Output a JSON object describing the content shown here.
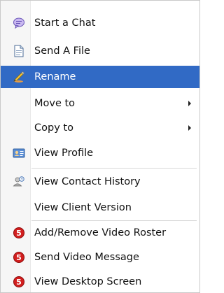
{
  "menu": {
    "items": [
      {
        "label": "Start a Chat",
        "icon": "chat-bubble-icon"
      },
      {
        "label": "Send A File",
        "icon": "file-icon"
      },
      {
        "label": "Rename",
        "icon": "rename-icon",
        "selected": true
      },
      {
        "label": "Move to",
        "submenu": true
      },
      {
        "label": "Copy to",
        "submenu": true
      },
      {
        "label": "View Profile",
        "icon": "profile-card-icon"
      },
      {
        "label": "View Contact History",
        "icon": "contact-history-icon"
      },
      {
        "label": "View Client Version"
      },
      {
        "label": "Add/Remove Video Roster",
        "icon": "video-icon"
      },
      {
        "label": "Send Video Message",
        "icon": "video-icon"
      },
      {
        "label": "View Desktop Screen",
        "icon": "video-icon"
      }
    ],
    "video_icon_glyph": "5"
  },
  "colors": {
    "selection": "#316ac5",
    "video_icon": "#d21e1e"
  }
}
